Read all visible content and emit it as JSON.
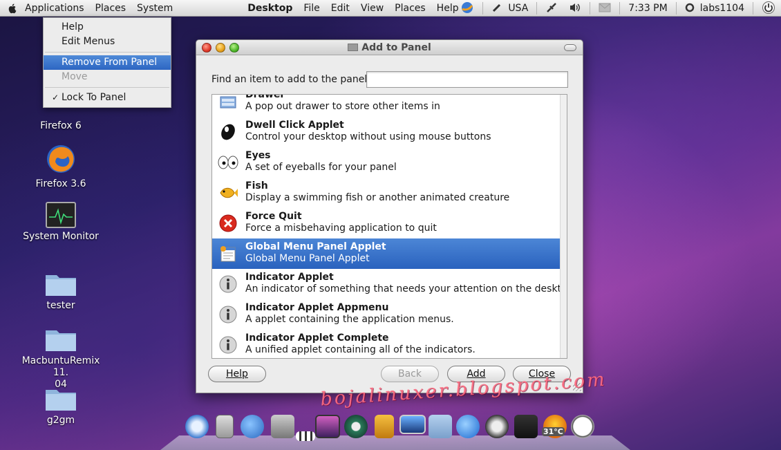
{
  "top_panel": {
    "menus": [
      "Applications",
      "Places",
      "System"
    ],
    "app_name": "Desktop",
    "app_menus": [
      "File",
      "Edit",
      "View",
      "Places",
      "Help"
    ],
    "keyboard_layout": "USA",
    "clock": "7:33 PM",
    "user": "labs1104"
  },
  "context_menu": {
    "items": [
      {
        "label": "Help",
        "state": "normal"
      },
      {
        "label": "Edit Menus",
        "state": "normal"
      },
      {
        "label": "Remove From Panel",
        "state": "highlighted"
      },
      {
        "label": "Move",
        "state": "disabled"
      },
      {
        "label": "Lock To Panel",
        "state": "checked"
      }
    ]
  },
  "desktop_icons": [
    {
      "label": "Firefox 6"
    },
    {
      "label": "Firefox 3.6"
    },
    {
      "label": "System Monitor"
    },
    {
      "label": "tester"
    },
    {
      "label": "MacbuntuRemix 11.\n04"
    },
    {
      "label": "g2gm"
    }
  ],
  "dialog": {
    "title": "Add to Panel",
    "find_label": "Find an item to add to the panel:",
    "find_value": "",
    "applets": [
      {
        "name": "Drawer",
        "description": "A pop out drawer to store other items in",
        "icon": "drawer-icon",
        "selected": false
      },
      {
        "name": "Dwell Click Applet",
        "description": "Control your desktop without using mouse buttons",
        "icon": "mouse-icon",
        "selected": false
      },
      {
        "name": "Eyes",
        "description": "A set of eyeballs for your panel",
        "icon": "eyes-icon",
        "selected": false
      },
      {
        "name": "Fish",
        "description": "Display a swimming fish or another animated creature",
        "icon": "fish-icon",
        "selected": false
      },
      {
        "name": "Force Quit",
        "description": "Force a misbehaving application to quit",
        "icon": "force-quit-icon",
        "selected": false
      },
      {
        "name": "Global Menu Panel Applet",
        "description": "Global Menu Panel Applet",
        "icon": "global-menu-icon",
        "selected": true
      },
      {
        "name": "Indicator Applet",
        "description": "An indicator of something that needs your attention on the desktop",
        "icon": "info-icon",
        "selected": false
      },
      {
        "name": "Indicator Applet Appmenu",
        "description": "A applet containing the application menus.",
        "icon": "info-icon",
        "selected": false
      },
      {
        "name": "Indicator Applet Complete",
        "description": "A unified applet containing all of the indicators.",
        "icon": "info-icon",
        "selected": false
      }
    ],
    "buttons": {
      "help": "Help",
      "back": "Back",
      "add": "Add",
      "close": "Close"
    }
  },
  "dock": {
    "weather": "31°C"
  },
  "watermark": "bojalinuxer.blogspot.com",
  "colors": {
    "selection": "#2f68c4",
    "panel": "#e4e4e4"
  }
}
